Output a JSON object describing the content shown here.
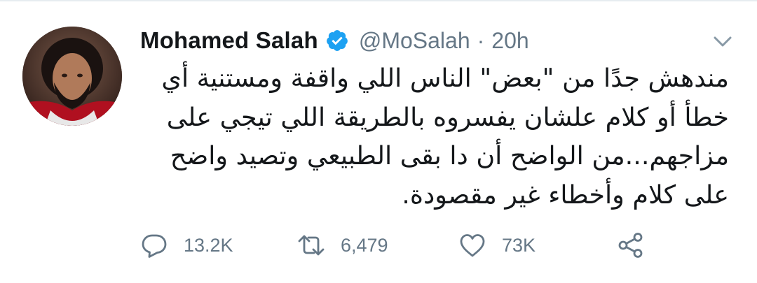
{
  "tweet": {
    "display_name": "Mohamed Salah",
    "handle": "@MoSalah",
    "separator": "·",
    "timestamp": "20h",
    "verified": true,
    "text_lines": [
      "مندهش جدًا من \"بعض\" الناس اللي واقفة ومستنية أي",
      "خطأ أو كلام علشان يفسروه بالطريقة اللي تيجي على",
      "مزاجهم...من الواضح أن دا بقى الطبيعي وتصيد واضح",
      "على كلام وأخطاء غير مقصودة."
    ]
  },
  "actions": {
    "reply_count": "13.2K",
    "retweet_count": "6,479",
    "like_count": "73K"
  },
  "icons": {
    "verified": "verified-badge-icon",
    "caret": "chevron-down-icon",
    "reply": "reply-icon",
    "retweet": "retweet-icon",
    "like": "heart-icon",
    "share": "share-icon"
  },
  "colors": {
    "text_primary": "#14171a",
    "text_secondary": "#657786",
    "verified_blue": "#1da1f2",
    "icon_gray": "#657786"
  }
}
